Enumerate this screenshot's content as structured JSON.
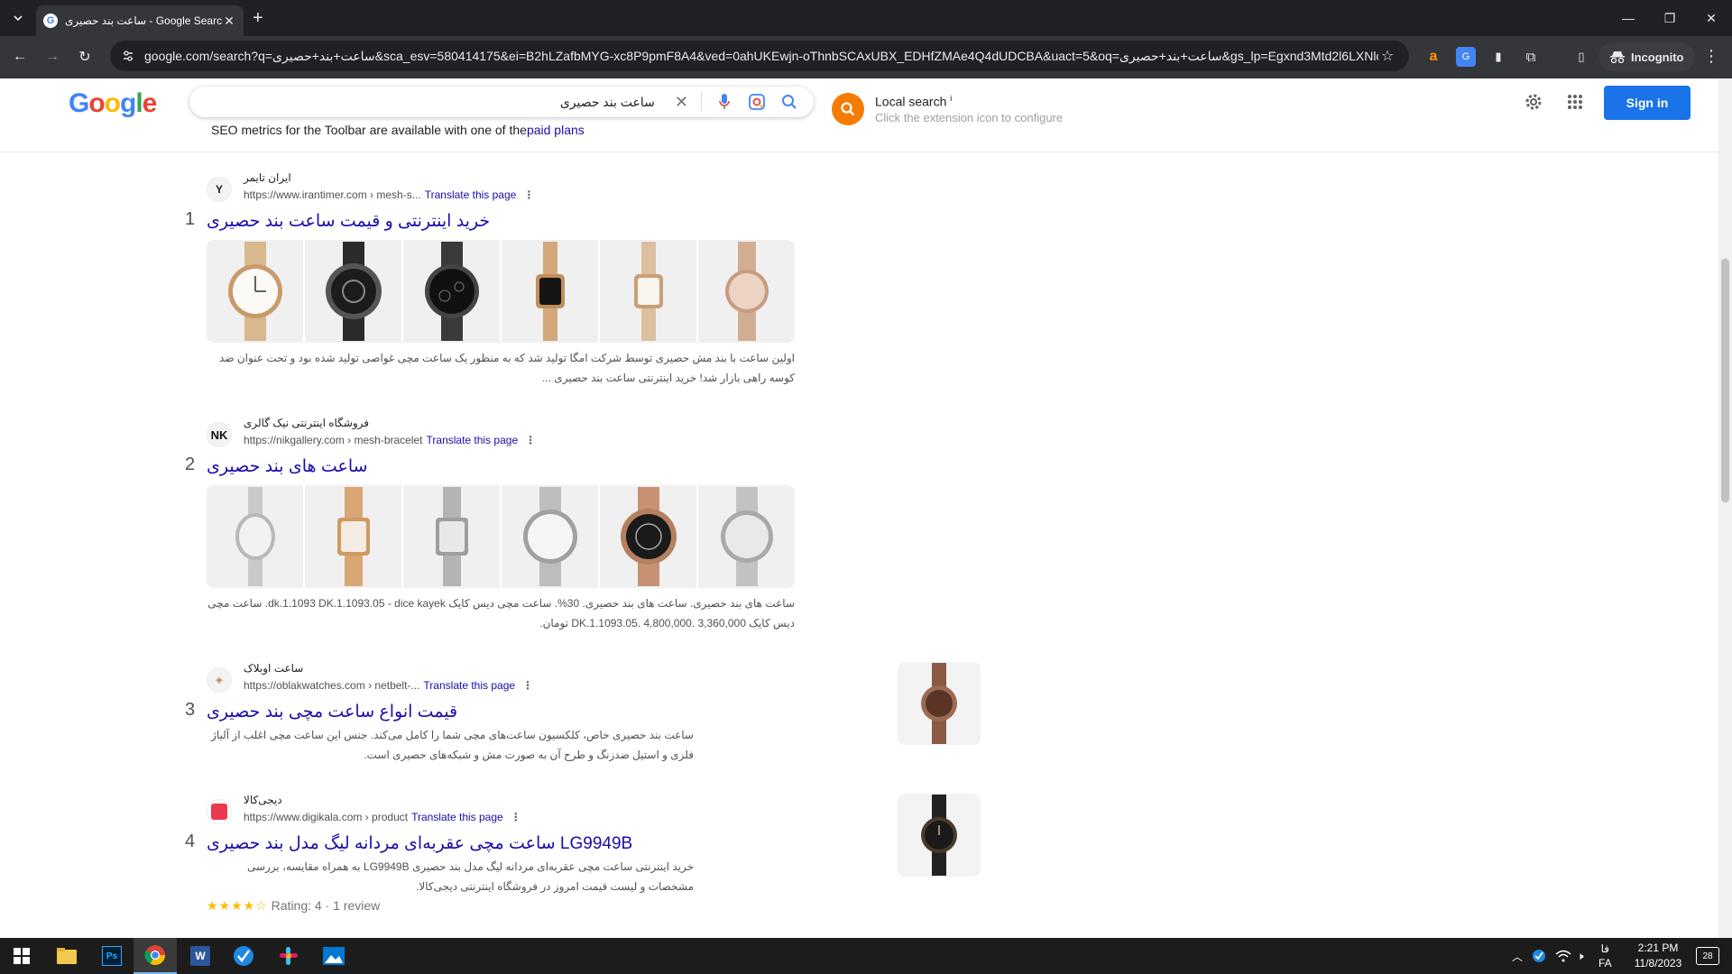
{
  "browser": {
    "tab_title": "ساعت بند حصیری - Google Search",
    "url": "google.com/search?q=ساعت+بند+حصیری&sca_esv=580414175&ei=B2hLZafbMYG-xc8P9pmF8A4&ved=0ahUKEwjn-oThnbSCAxUBX_EDHfZMAe4Q4dUDCBA&uact=5&oq=ساعت+بند+حصیری&gs_lp=Egxnd3Mtd2l6LXNlc...",
    "incognito_label": "Incognito"
  },
  "google": {
    "logo": [
      "G",
      "o",
      "o",
      "g",
      "l",
      "e"
    ],
    "logo_colors": [
      "#4285F4",
      "#EA4335",
      "#FBBC05",
      "#4285F4",
      "#34A853",
      "#EA4335"
    ],
    "query": "ساعت بند حصیری",
    "seo_text": "SEO metrics for the Toolbar are available with one of the",
    "seo_link": "paid plans",
    "local_title": "Local search",
    "local_info": "i",
    "local_sub": "Click the extension icon to configure",
    "signin": "Sign in"
  },
  "results": [
    {
      "num": "1",
      "site": "ایران تایمر",
      "url": "https://www.irantimer.com › mesh-s...",
      "translate": "Translate this page",
      "title": "خرید اینترنتی و قیمت ساعت بند حصیری",
      "snippet": "اولین ساعت با بند مش حصیری توسط شرکت امگا تولید شد که به منظور یک ساعت مچی غواصی تولید شده بود و تحت عنوان ضد کوسه راهی بازار شد! خرید اینترنتی ساعت بند حصیری ..."
    },
    {
      "num": "2",
      "site": "فروشگاه اینترنتی نیک گالری",
      "url": "https://nikgallery.com › mesh-bracelet",
      "translate": "Translate this page",
      "title": "ساعت های بند حصیری",
      "snippet": "ساعت های بند حصیری. ساعت های بند حصیری. 30%. ساعت مچی دیس کایک dk.1.1093 DK.1.1093.05 - dice kayek. ساعت مچی دیس کایک DK.1.1093.05. 4,800,000. 3,360,000 تومان."
    },
    {
      "num": "3",
      "site": "ساعت اوبلاک",
      "url": "https://oblakwatches.com › netbelt-...",
      "translate": "Translate this page",
      "title": "قیمت انواع ساعت مچی بند حصیری",
      "snippet": "ساعت بند حصیری خاص، کلکسیون ساعت‌های مچی شما را کامل می‌کند. جنس این ساعت مچی اغلب از آلیاژ فلزی و استیل ضدزنگ و طرح آن به صورت مش و شبکه‌های حصیری است."
    },
    {
      "num": "4",
      "site": "دیجی‌کالا",
      "url": "https://www.digikala.com › product",
      "translate": "Translate this page",
      "title": "ساعت مچی عقربه‌ای مردانه لیگ مدل بند حصیری LG9949B",
      "snippet": "خرید اینترنتی ساعت مچی عقربه‌ای مردانه لیگ مدل بند حصیری LG9949B به همراه مقایسه، بررسی مشخصات و لیست قیمت امروز در فروشگاه اینترنتی دیجی‌کالا.",
      "stars": "★★★★☆",
      "rating": "Rating: 4 · 1 review"
    }
  ],
  "taskbar": {
    "lang1": "فا",
    "lang2": "FA",
    "time": "2:21 PM",
    "date": "11/8/2023",
    "notif_count": "28"
  }
}
